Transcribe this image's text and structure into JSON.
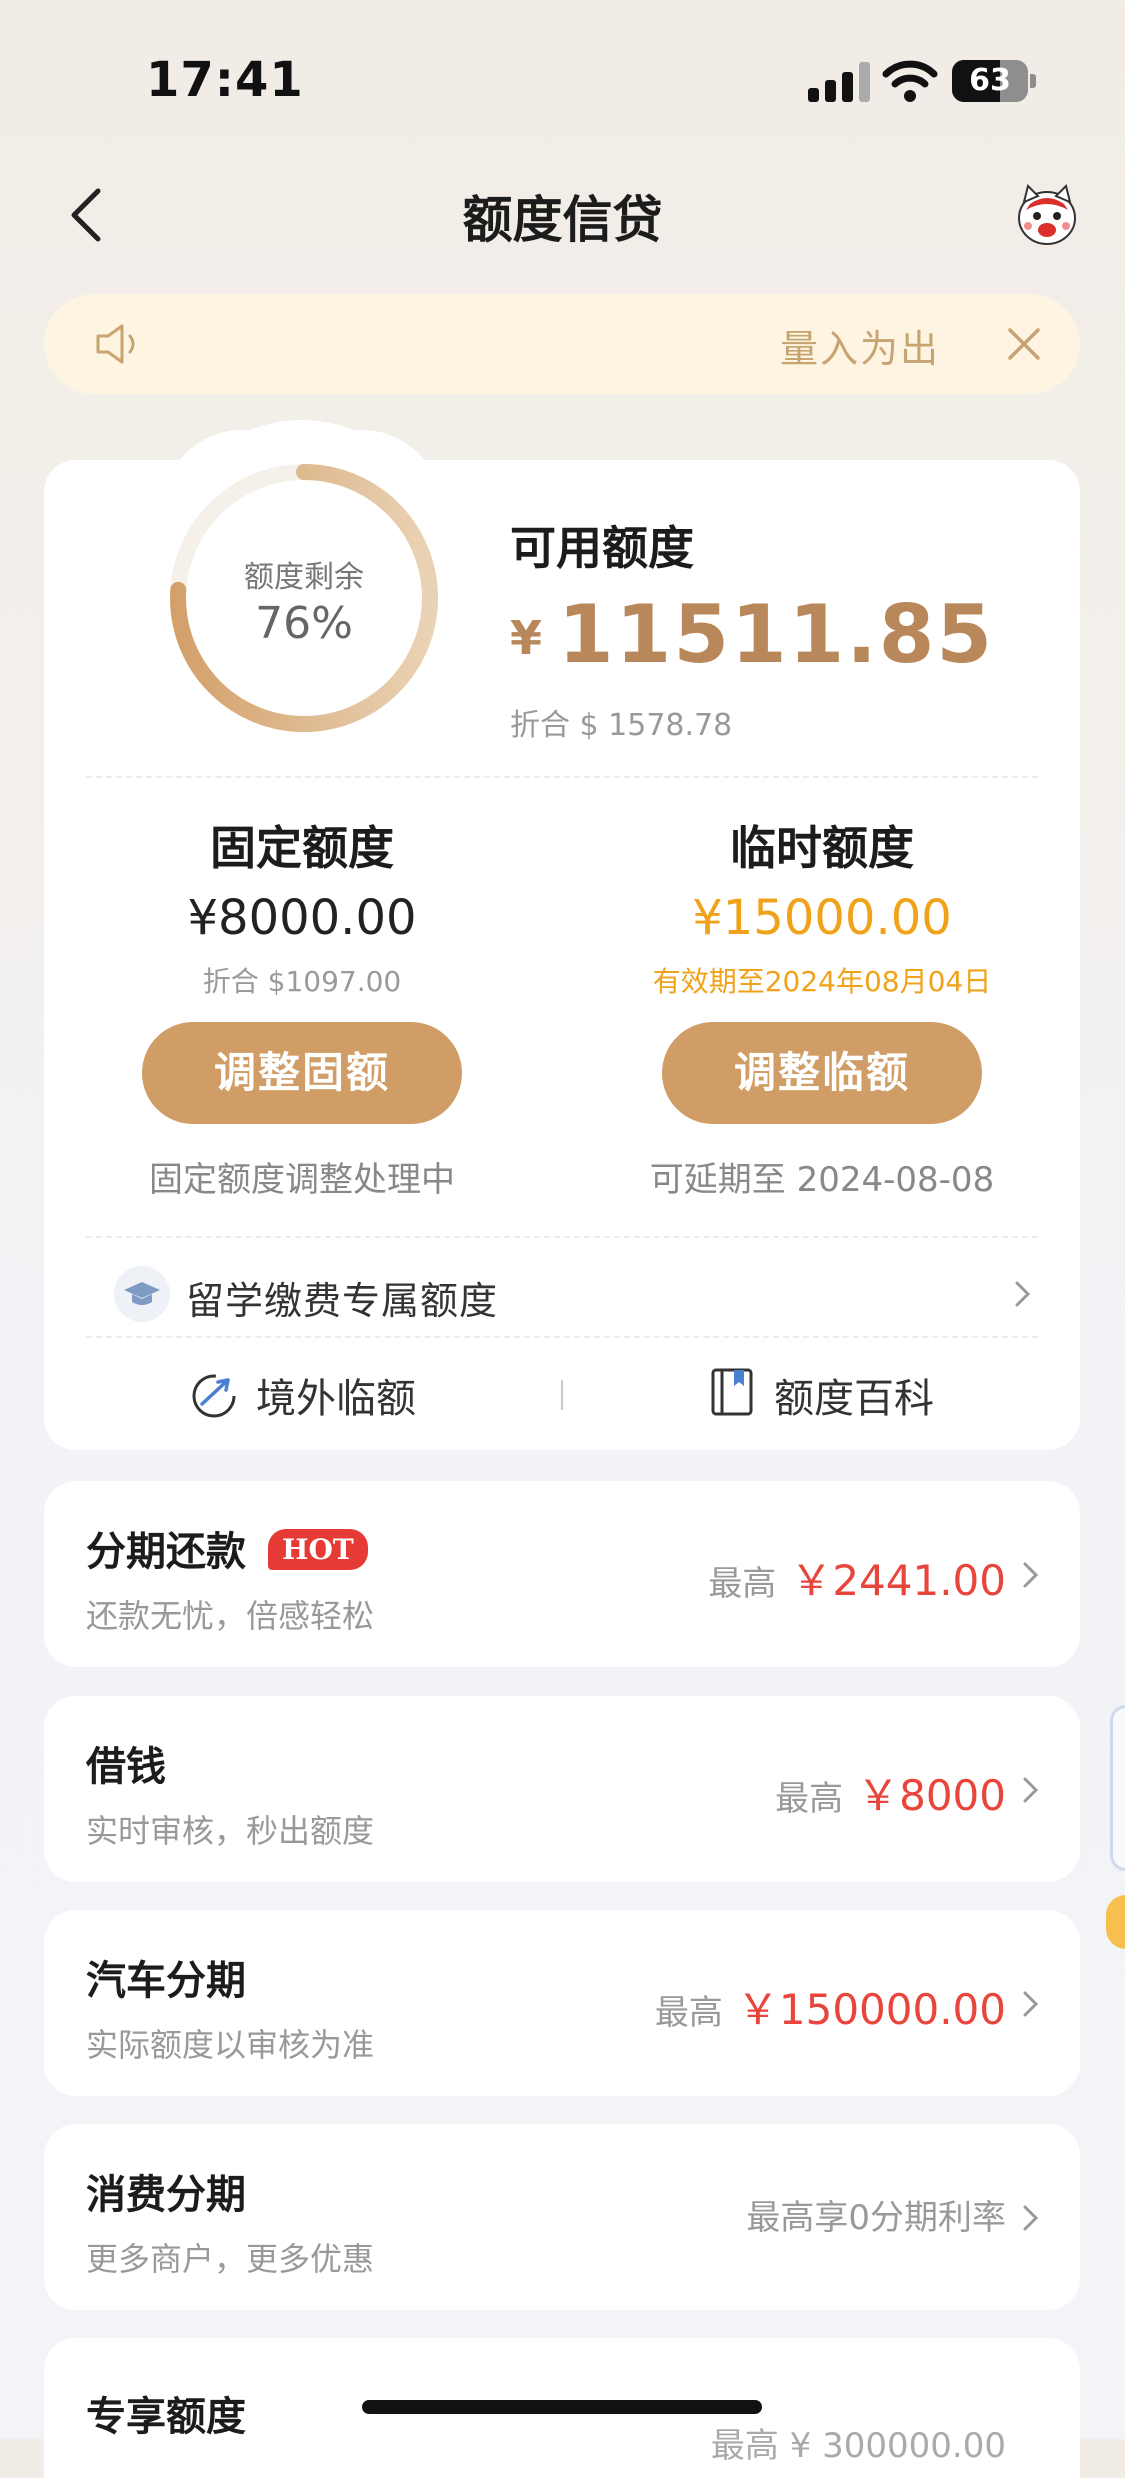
{
  "status_bar": {
    "time": "17:41",
    "battery": "63",
    "battery_level": 0.63
  },
  "nav": {
    "title": "额度信贷"
  },
  "notice": {
    "text": "量入为出"
  },
  "quota": {
    "ring_label": "额度剩余",
    "ring_percent_text": "76%",
    "ring_fraction": 0.76,
    "available_label": "可用额度",
    "currency_symbol": "¥",
    "available_amount": "11511.85",
    "available_usd": "折合 $ 1578.78"
  },
  "fixed": {
    "title": "固定额度",
    "amount": "¥8000.00",
    "usd": "折合 $1097.00",
    "button": "调整固额",
    "note": "固定额度调整处理中"
  },
  "temporary": {
    "title": "临时额度",
    "amount": "¥15000.00",
    "validity": "有效期至2024年08月04日",
    "button": "调整临额",
    "note": "可延期至 2024-08-08"
  },
  "study_abroad": {
    "label": "留学缴费专属额度"
  },
  "links": {
    "overseas": "境外临额",
    "wiki": "额度百科"
  },
  "products": [
    {
      "title": "分期还款",
      "badge": "HOT",
      "subtitle": "还款无忧，倍感轻松",
      "prefix": "最高",
      "amount": "￥2441.00"
    },
    {
      "title": "借钱",
      "subtitle": "实时审核，秒出额度",
      "prefix": "最高",
      "amount": "￥8000"
    },
    {
      "title": "汽车分期",
      "subtitle": "实际额度以审核为准",
      "prefix": "最高",
      "amount": "￥150000.00"
    },
    {
      "title": "消费分期",
      "subtitle": "更多商户，更多优惠",
      "prefix": "最高享0分期利率",
      "amount": ""
    },
    {
      "title": "专享额度",
      "subtitle": "",
      "prefix": "最高 ¥ 300000.00",
      "amount": ""
    }
  ],
  "colors": {
    "accent": "#cf9d65",
    "gold_text": "#b8875a",
    "orange": "#f0a21a",
    "red": "#e8453c"
  }
}
